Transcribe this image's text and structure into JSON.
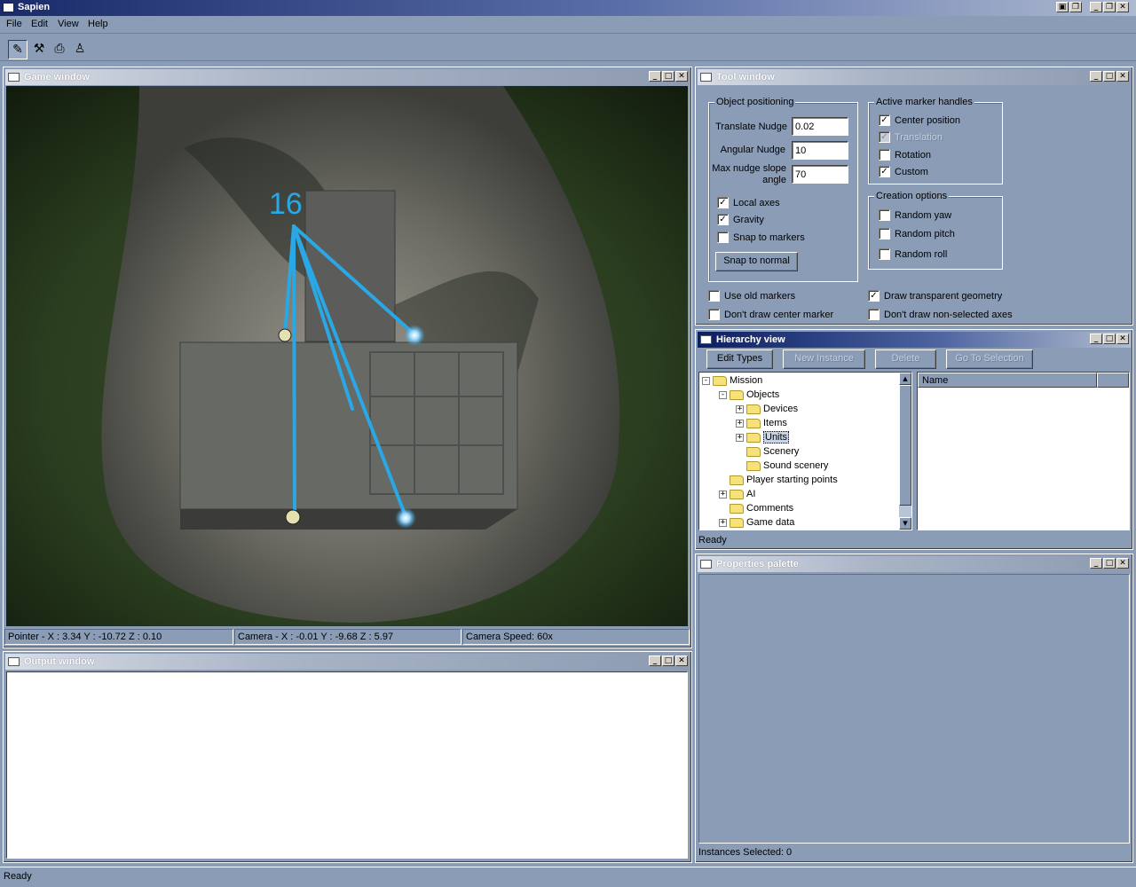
{
  "app": {
    "title": "Sapien"
  },
  "menu": [
    "File",
    "Edit",
    "View",
    "Help"
  ],
  "toolbar": {
    "icons": [
      "pencil-icon",
      "wand-icon",
      "camera-icon",
      "person-icon"
    ]
  },
  "game_window": {
    "title": "Game window",
    "overlay_label": "16",
    "status": {
      "pointer": "Pointer - X : 3.34  Y : -10.72  Z : 0.10",
      "camera": "Camera - X : -0.01  Y : -9.68  Z : 5.97",
      "speed": "Camera Speed: 60x"
    }
  },
  "output_window": {
    "title": "Output window"
  },
  "tool_window": {
    "title": "Tool window",
    "object_positioning": {
      "label": "Object positioning",
      "translate_nudge_label": "Translate Nudge",
      "translate_nudge_value": "0.02",
      "angular_nudge_label": "Angular Nudge",
      "angular_nudge_value": "10",
      "max_slope_label_1": "Max nudge slope",
      "max_slope_label_2": "angle",
      "max_slope_value": "70",
      "local_axes": "Local axes",
      "gravity": "Gravity",
      "snap_to_markers": "Snap to markers",
      "snap_to_normal": "Snap to normal"
    },
    "active_marker_handles": {
      "label": "Active marker handles",
      "center_position": "Center position",
      "translation": "Translation",
      "rotation": "Rotation",
      "custom": "Custom"
    },
    "creation_options": {
      "label": "Creation options",
      "random_yaw": "Random yaw",
      "random_pitch": "Random pitch",
      "random_roll": "Random roll"
    },
    "use_old_markers": "Use old markers",
    "dont_draw_center_marker": "Don't draw center marker",
    "draw_transparent_geometry": "Draw transparent geometry",
    "dont_draw_non_selected_axes": "Don't draw non-selected axes"
  },
  "hierarchy_view": {
    "title": "Hierarchy view",
    "buttons": {
      "edit_types": "Edit Types",
      "new_instance": "New Instance",
      "delete": "Delete",
      "go_to_selection": "Go To Selection"
    },
    "tree": {
      "mission": "Mission",
      "objects": "Objects",
      "devices": "Devices",
      "items": "Items",
      "units": "Units",
      "scenery": "Scenery",
      "sound_scenery": "Sound scenery",
      "player_starting_points": "Player starting points",
      "ai": "AI",
      "comments": "Comments",
      "game_data": "Game data"
    },
    "list_header": "Name",
    "status": "Ready"
  },
  "properties_palette": {
    "title": "Properties palette",
    "status": "Instances Selected: 0"
  },
  "statusbar": {
    "text": "Ready"
  },
  "colors": {
    "accent": "#2aa8e6",
    "title_active": "#0a1e62",
    "background": "#8a9cb6"
  }
}
